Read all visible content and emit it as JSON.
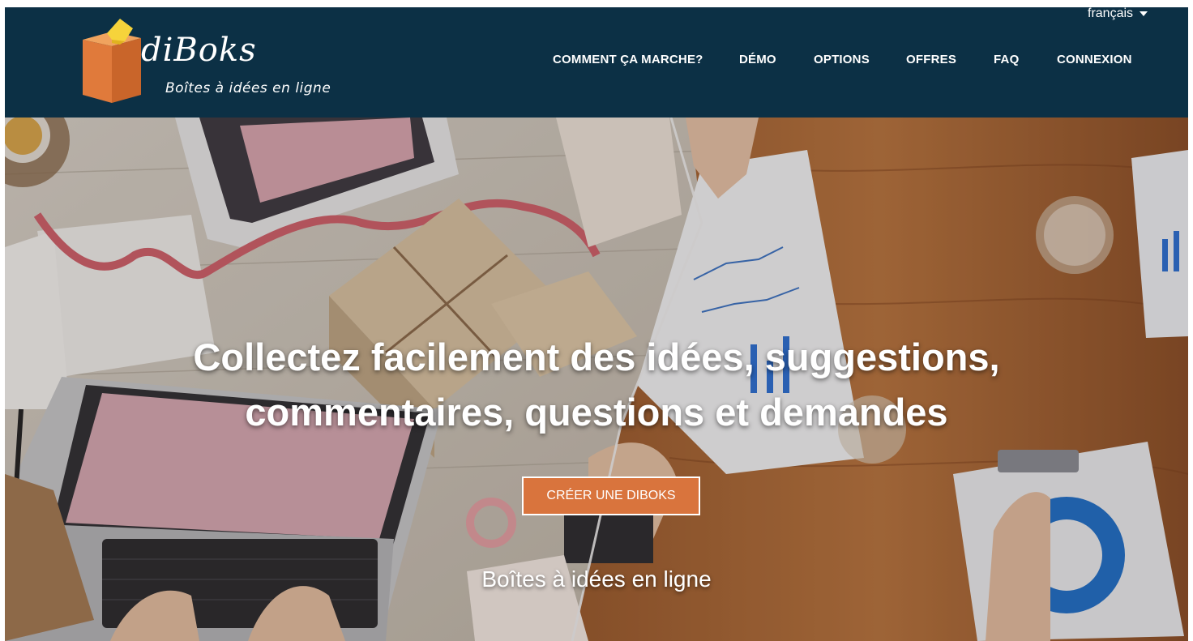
{
  "header": {
    "logo": {
      "wordmark": "diBoks",
      "tagline": "Boîtes à idées en ligne",
      "icon": "idea-box-icon"
    },
    "language": {
      "selected": "français",
      "icon": "caret-down-icon"
    },
    "nav": [
      {
        "label": "COMMENT ÇA MARCHE?"
      },
      {
        "label": "DÉMO"
      },
      {
        "label": "OPTIONS"
      },
      {
        "label": "OFFRES"
      },
      {
        "label": "FAQ"
      },
      {
        "label": "CONNEXION"
      }
    ]
  },
  "hero": {
    "title_line1": "Collectez facilement des idées, suggestions,",
    "title_line2": "commentaires, questions et demandes",
    "cta_label": "CRÉER UNE DIBOKS",
    "subtitle": "Boîtes à idées en ligne"
  },
  "colors": {
    "header_bg": "#0c3045",
    "accent": "#d9743d",
    "text_light": "#ffffff"
  }
}
